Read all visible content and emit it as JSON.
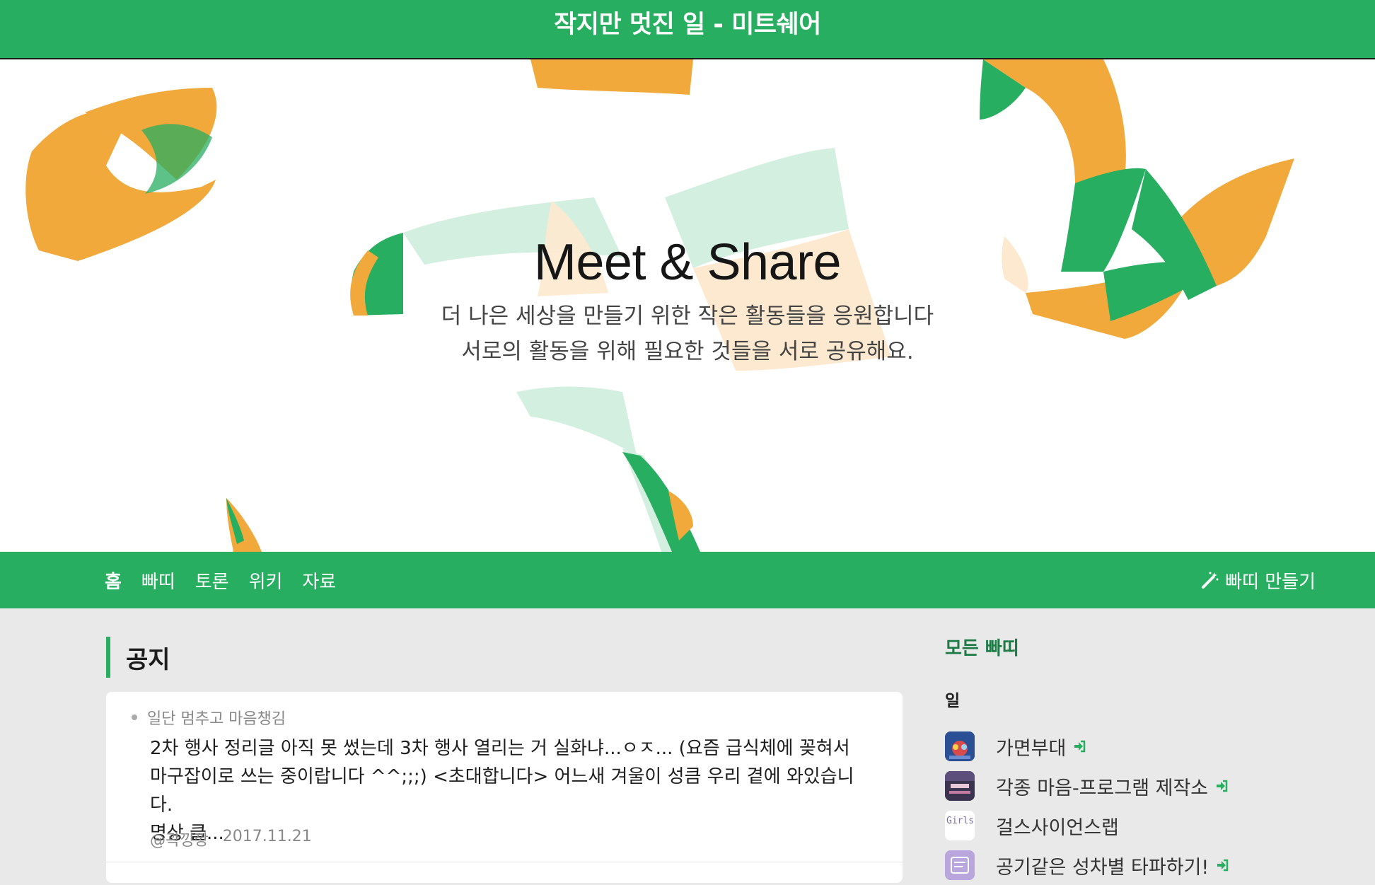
{
  "topbar": {
    "title": "작지만 멋진 일 - 미트쉐어"
  },
  "hero": {
    "title": "Meet & Share",
    "subtitle_line1": "더 나은 세상을 만들기 위한 작은 활동들을 응원합니다",
    "subtitle_line2": "서로의 활동을 위해 필요한 것들을 서로 공유해요."
  },
  "nav": {
    "items": [
      "홈",
      "빠띠",
      "토론",
      "위키",
      "자료"
    ],
    "create_label": "빠띠 만들기",
    "create_icon": "magic-wand-icon"
  },
  "notice": {
    "heading": "공지",
    "post": {
      "tag": "일단 멈추고 마음챙김",
      "excerpt_line1": "2차 행사 정리글 아직 못 썼는데 3차 행사 열리는 거 실화냐...ㅇㅈ... (요즘 급식체에 꽂혀서",
      "excerpt_line2": "마구잡이로 쓰는 중이랍니다 ^^;;;) <초대합니다> 어느새 겨울이 성큼 우리 곁에 와있습니다.",
      "excerpt_line3": "명상 클...",
      "author": "@곽낑깡",
      "date": "2017.11.21"
    }
  },
  "sidebar": {
    "title": "모든 빠띠",
    "category": "일",
    "groups": [
      {
        "name": "가면부대",
        "joinable": true,
        "thumb_color": "#1f3f7a"
      },
      {
        "name": "각종 마음-프로그램 제작소",
        "joinable": true,
        "thumb_color": "#3a3450"
      },
      {
        "name": "걸스사이언스랩",
        "joinable": false,
        "thumb_color": "#ffffff",
        "thumb_text": "Girls' Lab"
      },
      {
        "name": "공기같은 성차별 타파하기!",
        "joinable": true,
        "thumb_color": "#b8a6dc"
      }
    ],
    "enter_icon": "sign-in-icon"
  },
  "colors": {
    "brand_green": "#27ae60",
    "accent_orange": "#f2a93b",
    "dark_green_text": "#1e7b46"
  }
}
